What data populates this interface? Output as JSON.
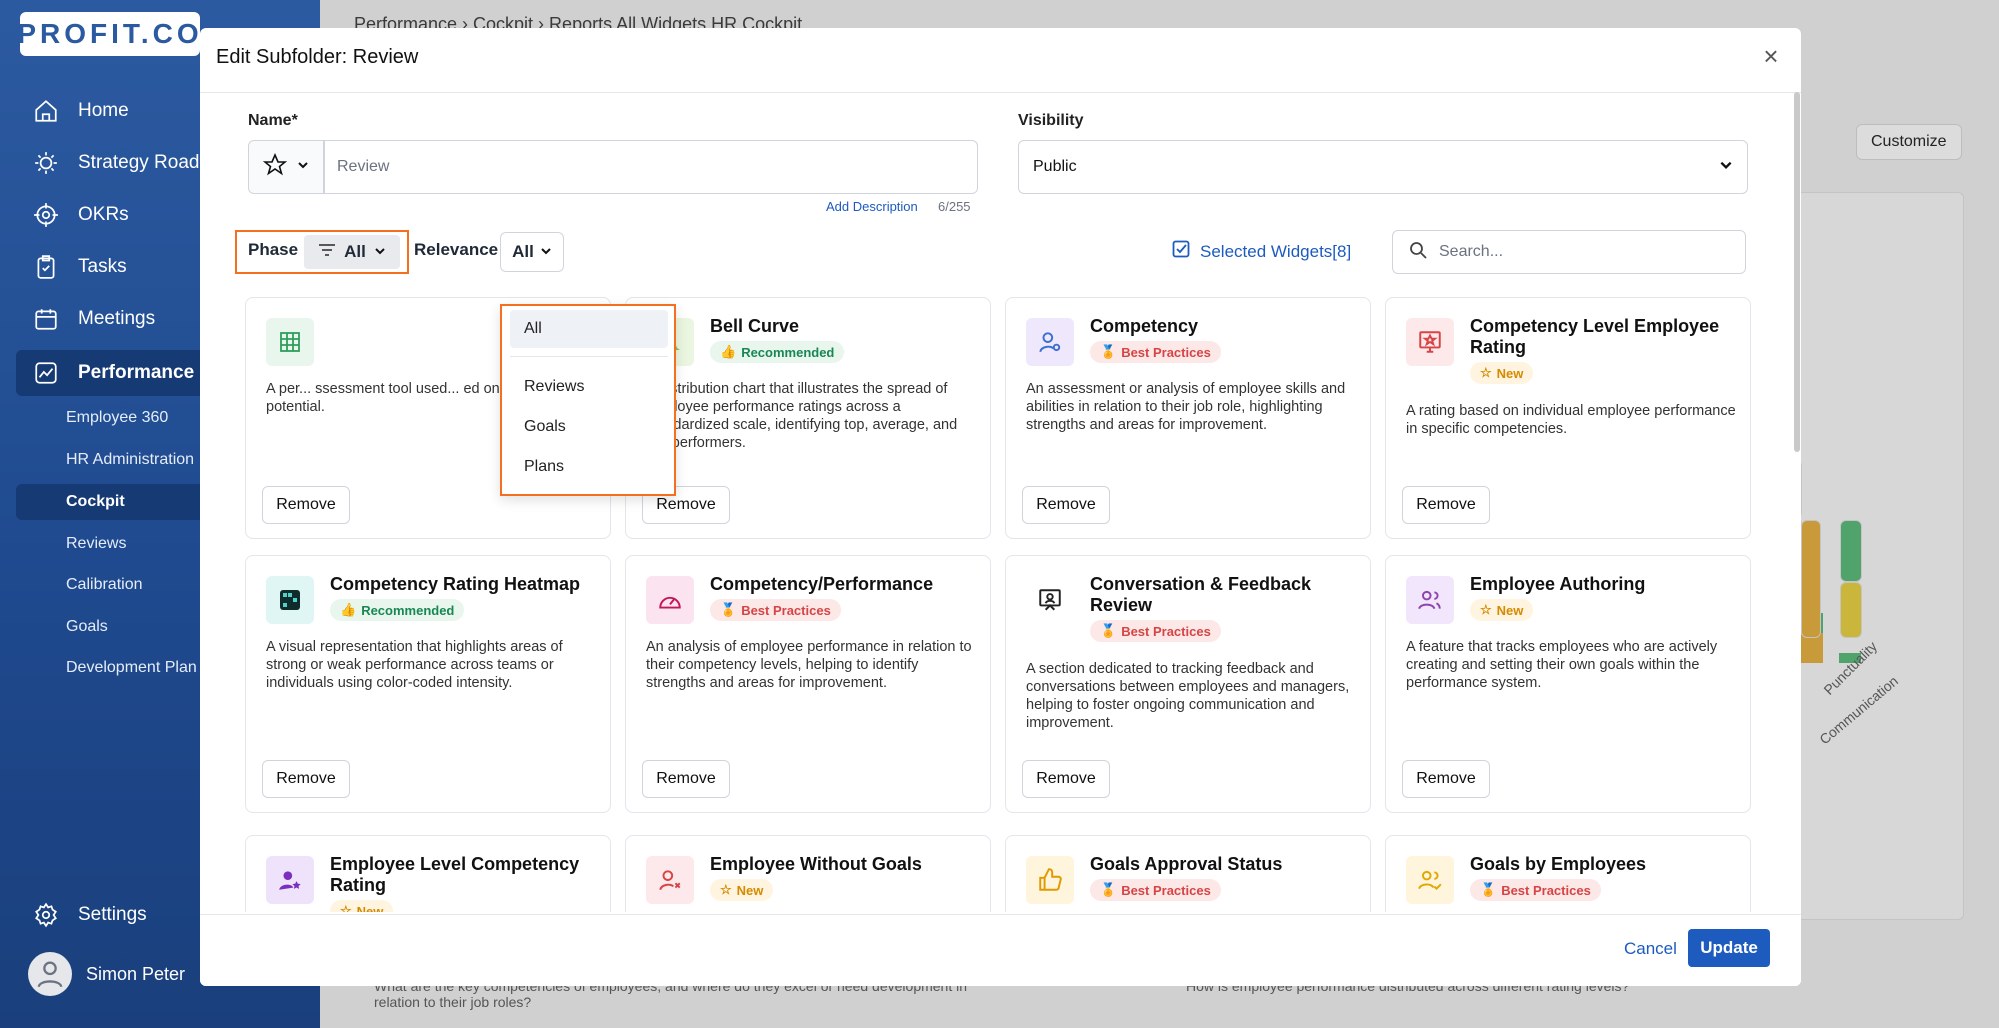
{
  "app": {
    "logo": "PROFIT.CO"
  },
  "sidebar": {
    "items": [
      {
        "label": "Home",
        "icon": "home-icon"
      },
      {
        "label": "Strategy Roadm",
        "icon": "bulb-icon"
      },
      {
        "label": "OKRs",
        "icon": "target-icon"
      },
      {
        "label": "Tasks",
        "icon": "clipboard-icon"
      },
      {
        "label": "Meetings",
        "icon": "calendar-icon"
      },
      {
        "label": "Performance",
        "icon": "chart-icon"
      }
    ],
    "subitems": [
      "Employee 360",
      "HR Administration",
      "Cockpit",
      "Reviews",
      "Calibration",
      "Goals",
      "Development Plan"
    ],
    "settings": "Settings",
    "user": "Simon Peter"
  },
  "background": {
    "breadcrumb": "Performance  ›  Cockpit  ›   Reports    All Widgets    HR Cockpit ...",
    "customize": "Customize",
    "bottom_left_q": "What are the key competencies of employees, and where do they excel or need development in relation to their job roles?",
    "bottom_right_q": "How is employee performance distributed across different rating levels?",
    "chart_labels": [
      "Punctuality",
      "Communication"
    ]
  },
  "modal": {
    "title": "Edit Subfolder: Review",
    "name_label": "Name*",
    "name_value": "Review",
    "add_description": "Add Description",
    "char_count": "6/255",
    "visibility_label": "Visibility",
    "visibility_value": "Public",
    "phase_label": "Phase",
    "phase_value": "All",
    "relevance_label": "Relevance",
    "relevance_value": "All",
    "selected_widgets": "Selected Widgets[8]",
    "search_placeholder": "Search...",
    "remove_label": "Remove",
    "cancel": "Cancel",
    "update": "Update"
  },
  "phase_dropdown": [
    "All",
    "Reviews",
    "Goals",
    "Plans"
  ],
  "cards": [
    {
      "title": "",
      "badge": "",
      "badge_type": "",
      "desc": "A per... ssessment tool used... ed on their perfo... potential.",
      "icon": "table-icon",
      "color": "#e8f6ee",
      "ic": "#2e9e5b"
    },
    {
      "title": "Bell Curve",
      "badge": "Recommended",
      "badge_type": "rec",
      "desc": "A distribution chart that illustrates the spread of employee performance ratings across a standardized scale, identifying top, average, and low performers.",
      "icon": "bell-curve-icon",
      "color": "#eaf6e0",
      "ic": "#7cb342"
    },
    {
      "title": "Competency",
      "badge": "Best Practices",
      "badge_type": "bp",
      "desc": "An assessment or analysis of employee skills and abilities in relation to their job role, highlighting strengths and areas for improvement.",
      "icon": "user-gear-icon",
      "color": "#efe7fb",
      "ic": "#3b6fd1"
    },
    {
      "title": "Competency Level Employee Rating",
      "badge": "New",
      "badge_type": "new",
      "desc": "A rating based on individual employee performance in specific competencies.",
      "icon": "monitor-star-icon",
      "color": "#fde8ea",
      "ic": "#d64545"
    },
    {
      "title": "Competency Rating Heatmap",
      "badge": "Recommended",
      "badge_type": "rec",
      "desc": "A visual representation that highlights areas of strong or weak performance across teams or individuals using color-coded intensity.",
      "icon": "heatmap-icon",
      "color": "#e0f6f4",
      "ic": "#0f2b2b"
    },
    {
      "title": "Competency/Performance",
      "badge": "Best Practices",
      "badge_type": "bp",
      "desc": "An analysis of employee performance in relation to their competency levels, helping to identify strengths and areas for improvement.",
      "icon": "gauge-icon",
      "color": "#fbe3ef",
      "ic": "#c2185b"
    },
    {
      "title": "Conversation & Feedback Review",
      "badge": "Best Practices",
      "badge_type": "bp",
      "desc": "A section dedicated to tracking feedback and conversations between employees and managers, helping to foster ongoing communication and improvement.",
      "icon": "presentation-icon",
      "color": "#ffffff",
      "ic": "#222222"
    },
    {
      "title": "Employee Authoring",
      "badge": "New",
      "badge_type": "new",
      "desc": "A feature that tracks employees who are actively creating and setting their own goals within the performance system.",
      "icon": "users-icon",
      "color": "#f1e6fb",
      "ic": "#8e44ad"
    },
    {
      "title": "Employee Level Competency Rating",
      "badge": "New",
      "badge_type": "new",
      "desc": "",
      "icon": "user-star-icon",
      "color": "#efe3fb",
      "ic": "#7b2fbf"
    },
    {
      "title": "Employee Without Goals",
      "badge": "New",
      "badge_type": "new",
      "desc": "",
      "icon": "user-x-icon",
      "color": "#fde8ec",
      "ic": "#d64545"
    },
    {
      "title": "Goals Approval Status",
      "badge": "Best Practices",
      "badge_type": "bp",
      "desc": "",
      "icon": "thumbs-up-icon",
      "color": "#fff4dc",
      "ic": "#e09a00"
    },
    {
      "title": "Goals by Employees",
      "badge": "Best Practices",
      "badge_type": "bp",
      "desc": "",
      "icon": "users-check-icon",
      "color": "#fff4dc",
      "ic": "#e0a800"
    }
  ]
}
